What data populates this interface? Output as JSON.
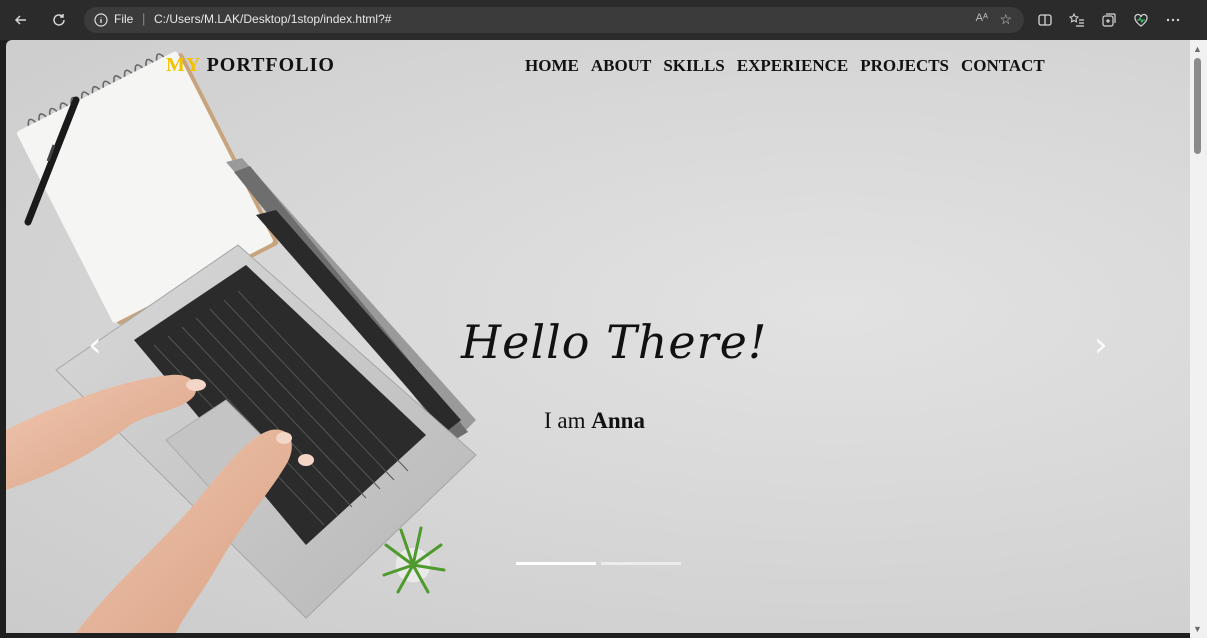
{
  "browser": {
    "protocol_label": "File",
    "url": "C:/Users/M.LAK/Desktop/1stop/index.html?#",
    "read_aloud": "Aᴬ"
  },
  "site": {
    "logo_prefix": "MY",
    "logo_rest": "PORTFOLIO",
    "nav": [
      "HOME",
      "ABOUT",
      "SKILLS",
      "EXPERIENCE",
      "PROJECTS",
      "CONTACT"
    ]
  },
  "hero": {
    "greeting": "Hello There!",
    "intro_prefix": "I am ",
    "name": "Anna"
  },
  "carousel": {
    "prev_glyph": "‹",
    "next_glyph": "›",
    "slides": 2,
    "active_slide": 1
  },
  "colors": {
    "accent": "#f2c200",
    "chrome": "#2b2b2b"
  }
}
